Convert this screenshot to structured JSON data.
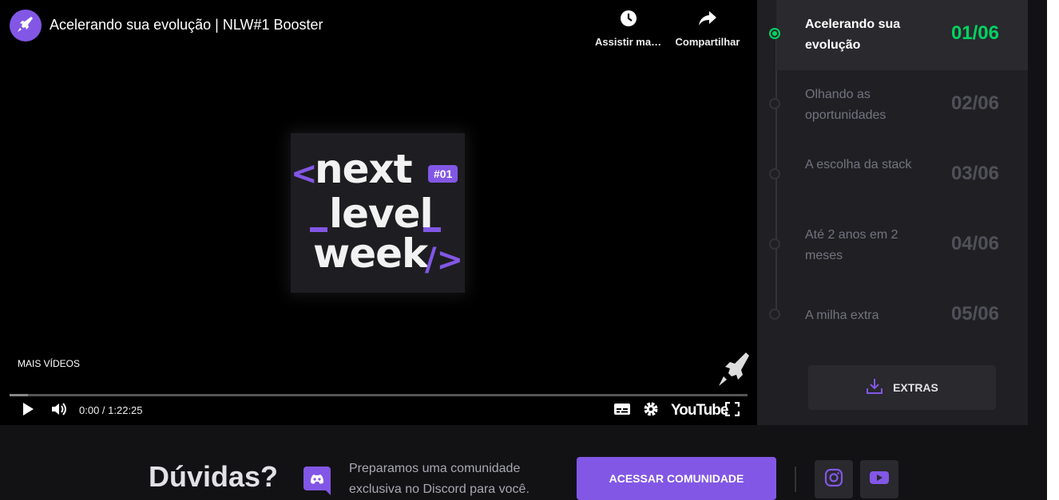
{
  "video": {
    "title": "Acelerando sua evolução | NLW#1 Booster",
    "watch_later_label": "Assistir mais tarde",
    "share_label": "Compartilhar",
    "more_videos_label": "MAIS VÍDEOS",
    "time_display": "0:00 / 1:22:25",
    "progress_fraction": 0.025,
    "youtube_label": "YouTube",
    "thumbnail": {
      "line1": "next",
      "line2": "level",
      "line3": "week",
      "bracket_open": "<",
      "bracket_close": "/>",
      "edition": "#01"
    }
  },
  "lessons": [
    {
      "title": "Acelerando sua evolução",
      "number": "01/06",
      "active": true
    },
    {
      "title": "Olhando as oportunidades",
      "number": "02/06",
      "active": false
    },
    {
      "title": "A escolha da stack",
      "number": "03/06",
      "active": false
    },
    {
      "title": "Até 2 anos em 2 meses",
      "number": "04/06",
      "active": false
    },
    {
      "title": "A milha extra",
      "number": "05/06",
      "active": false
    }
  ],
  "extras": {
    "label": "EXTRAS"
  },
  "footer": {
    "faq_title": "Dúvidas?",
    "community_text": "Preparamos uma comunidade exclusiva no Discord para você.",
    "community_button": "ACESSAR COMUNIDADE"
  },
  "colors": {
    "accent_purple": "#8257e5",
    "active_green": "#04d361",
    "sidebar_bg": "#202024",
    "active_row_bg": "#29292e"
  },
  "icons": [
    "rocket-icon",
    "clock-icon",
    "share-icon",
    "play-icon",
    "volume-icon",
    "captions-icon",
    "gear-icon",
    "fullscreen-icon",
    "download-icon",
    "discord-icon",
    "instagram-icon",
    "youtube-icon"
  ]
}
